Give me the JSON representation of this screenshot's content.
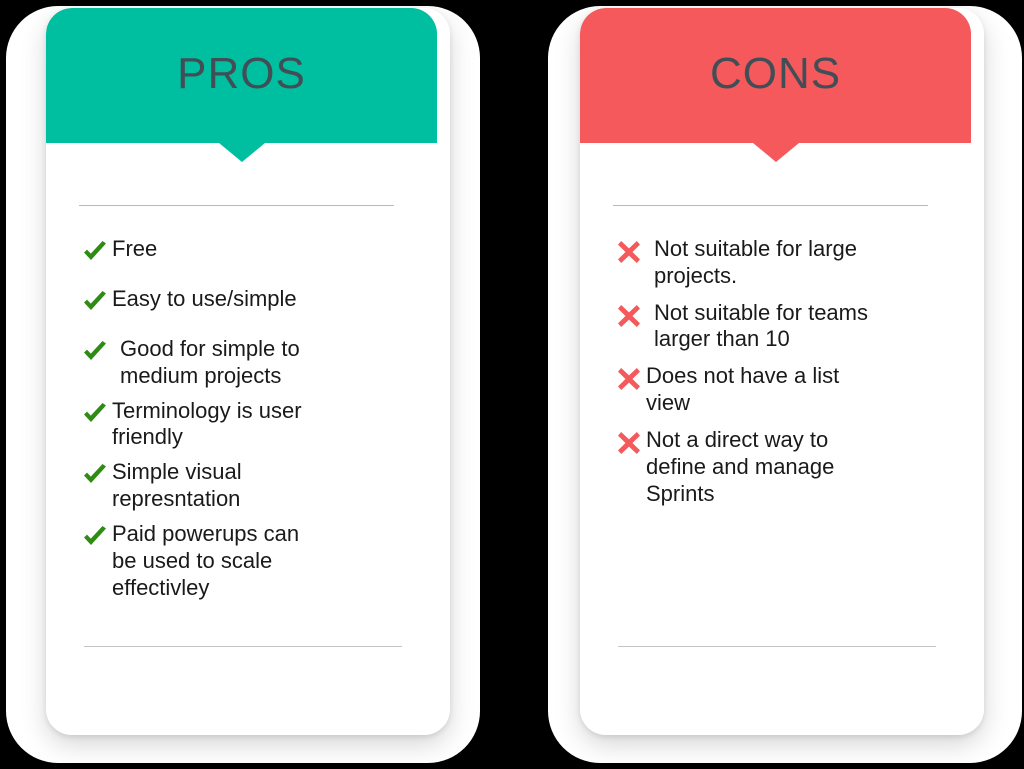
{
  "background_color": "#000000",
  "cards": [
    {
      "id": "pros",
      "title": "PROS",
      "accent_color": "#00bfa0",
      "title_color": "#414e56",
      "icon": "check-icon",
      "icon_color": "#2e8b13",
      "items": [
        {
          "text": "Free"
        },
        {
          "text": "Easy to use/simple"
        },
        {
          "text": " Good for simple to\n  medium projects"
        },
        {
          "text": "Terminology is user\nfriendly"
        },
        {
          "text": "Simple visual\nrepresntation"
        },
        {
          "text": "Paid powerups can\nbe used to scale\neffectivley"
        }
      ]
    },
    {
      "id": "cons",
      "title": "CONS",
      "accent_color": "#f5595b",
      "title_color": "#414e56",
      "icon": "cross-icon",
      "icon_color": "#f4595b",
      "items": [
        {
          "text": " Not suitable for large\n  projects."
        },
        {
          "text": " Not suitable for teams\n larger than 10"
        },
        {
          "text": "Does not have a list\nview"
        },
        {
          "text": "Not a direct way to\ndefine and manage\nSprints"
        }
      ]
    }
  ]
}
